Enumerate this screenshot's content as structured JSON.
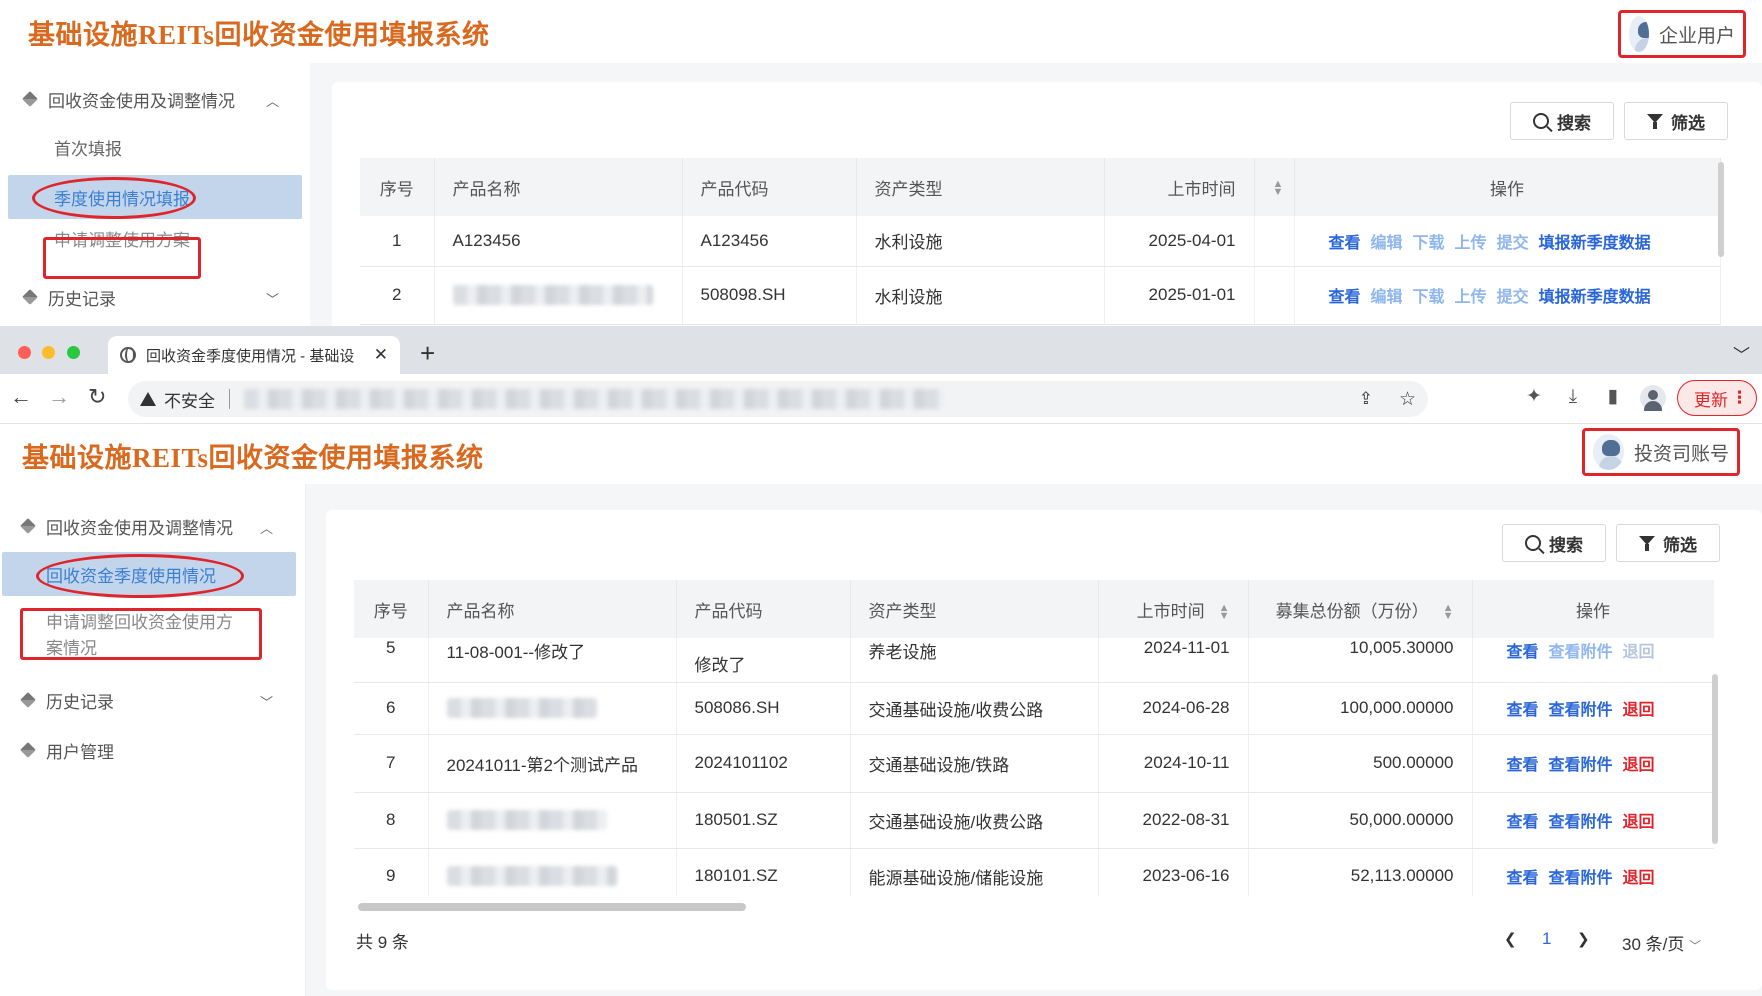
{
  "app_title": "基础设施REITs回收资金使用填报系统",
  "icons": {
    "user": "avatar",
    "group": "cube-icon",
    "search": "search-icon",
    "filter": "filter-icon"
  },
  "colors": {
    "accent": "#2a66d9",
    "title": "#d9691f",
    "highlight": "#e0242b",
    "active_menu": "#c2d5ea"
  },
  "top": {
    "user_name": "企业用户",
    "menu_group1": "回收资金使用及调整情况",
    "menu_items": [
      "首次填报",
      "季度使用情况填报",
      "申请调整使用方案"
    ],
    "menu_group2": "历史记录",
    "search_label": "搜索",
    "filter_label": "筛选",
    "columns": [
      "序号",
      "产品名称",
      "产品代码",
      "资产类型",
      "上市时间",
      "操作"
    ],
    "rows": [
      {
        "no": "1",
        "name": "A123456",
        "code": "A123456",
        "type": "水利设施",
        "date": "2025-04-01"
      },
      {
        "no": "2",
        "name": "",
        "code": "508098.SH",
        "type": "水利设施",
        "date": "2025-01-01"
      }
    ],
    "actions": [
      "查看",
      "编辑",
      "下载",
      "上传",
      "提交",
      "填报新季度数据"
    ]
  },
  "browser": {
    "tab_title": "回收资金季度使用情况 - 基础设",
    "new_tab": "+",
    "security_label": "不安全",
    "update_label": "更新",
    "kebab": "⋮"
  },
  "bottom": {
    "user_name": "投资司账号",
    "menu_group1": "回收资金使用及调整情况",
    "menu_item_active": "回收资金季度使用情况",
    "menu_item_2_line1": "申请调整回收资金使用方",
    "menu_item_2_line2": "案情况",
    "menu_group2": "历史记录",
    "menu_group3": "用户管理",
    "search_label": "搜索",
    "filter_label": "筛选",
    "columns": [
      "序号",
      "产品名称",
      "产品代码",
      "资产类型",
      "上市时间",
      "募集总份额（万份）",
      "操作"
    ],
    "rows": [
      {
        "no": "5",
        "name": "11-08-001--修改了",
        "code": "修改了",
        "type": "养老设施",
        "date": "2024-11-01",
        "amount": "10,005.30000"
      },
      {
        "no": "6",
        "name": "",
        "code": "508086.SH",
        "type": "交通基础设施/收费公路",
        "date": "2024-06-28",
        "amount": "100,000.00000"
      },
      {
        "no": "7",
        "name": "20241011-第2个测试产品",
        "code": "2024101102",
        "type": "交通基础设施/铁路",
        "date": "2024-10-11",
        "amount": "500.00000"
      },
      {
        "no": "8",
        "name": "",
        "code": "180501.SZ",
        "type": "交通基础设施/收费公路",
        "date": "2022-08-31",
        "amount": "50,000.00000"
      },
      {
        "no": "9",
        "name": "",
        "code": "180101.SZ",
        "type": "能源基础设施/储能设施",
        "date": "2023-06-16",
        "amount": "52,113.00000"
      }
    ],
    "actions": [
      "查看",
      "查看附件",
      "退回"
    ],
    "total": "共 9 条",
    "page": "1",
    "page_size": "30 条/页"
  }
}
